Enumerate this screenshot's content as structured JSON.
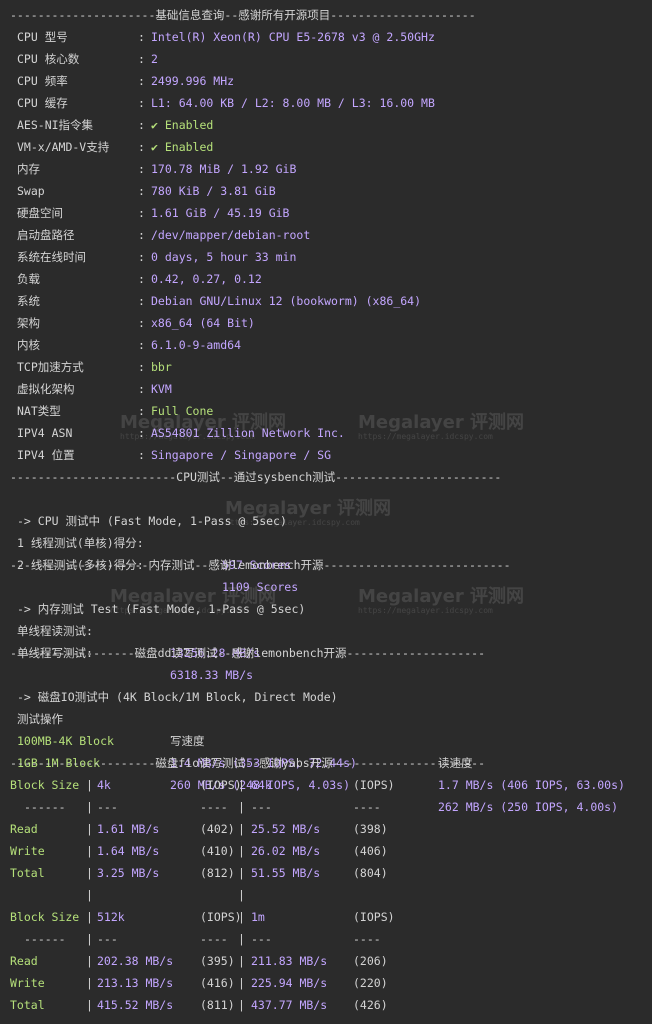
{
  "sections": {
    "basic": "---------------------基础信息查询--感谢所有开源项目---------------------",
    "cpu": "------------------------CPU测试--通过sysbench测试------------------------",
    "mem": "--------------------内存测试--感谢lemonbench开源---------------------------",
    "dd": "------------------磁盘dd读写测试--感谢lemonbench开源--------------------",
    "fio": "---------------------磁盘fio读写测试--感谢yabs开源----------------------"
  },
  "info": [
    {
      "label": "CPU 型号",
      "value": "Intel(R) Xeon(R) CPU E5-2678 v3 @ 2.50GHz"
    },
    {
      "label": "CPU 核心数",
      "value": "2"
    },
    {
      "label": "CPU 频率",
      "value": "2499.996 MHz"
    },
    {
      "label": "CPU 缓存",
      "value": "L1: 64.00 KB / L2: 8.00 MB / L3: 16.00 MB"
    },
    {
      "label": "AES-NI指令集",
      "value": "✔ Enabled"
    },
    {
      "label": "VM-x/AMD-V支持",
      "value": "✔ Enabled"
    },
    {
      "label": "内存",
      "value": "170.78 MiB / 1.92 GiB"
    },
    {
      "label": "Swap",
      "value": "780 KiB / 3.81 GiB"
    },
    {
      "label": "硬盘空间",
      "value": "1.61 GiB / 45.19 GiB"
    },
    {
      "label": "启动盘路径",
      "value": "/dev/mapper/debian-root"
    },
    {
      "label": "系统在线时间",
      "value": "0 days, 5 hour 33 min"
    },
    {
      "label": "负载",
      "value": "0.42, 0.27, 0.12"
    },
    {
      "label": "系统",
      "value": "Debian GNU/Linux 12 (bookworm) (x86_64)"
    },
    {
      "label": "架构",
      "value": "x86_64 (64 Bit)"
    },
    {
      "label": "内核",
      "value": "6.1.0-9-amd64"
    },
    {
      "label": "TCP加速方式",
      "value": "bbr"
    },
    {
      "label": "虚拟化架构",
      "value": "KVM"
    },
    {
      "label": "NAT类型",
      "value": "Full Cone"
    },
    {
      "label": "IPV4 ASN",
      "value": "AS54801 Zillion Network Inc."
    },
    {
      "label": "IPV4 位置",
      "value": "Singapore / Singapore / SG"
    }
  ],
  "colon": ":",
  "cpu_test": {
    "header": "-> CPU 测试中 (Fast Mode, 1-Pass @ 5sec)",
    "rows": [
      {
        "label": "1 线程测试(单核)得分:",
        "value": "597 Scores"
      },
      {
        "label": "2 线程测试(多核)得分:",
        "value": "1109 Scores"
      }
    ]
  },
  "mem_test": {
    "header": "-> 内存测试 Test (Fast Mode, 1-Pass @ 5sec)",
    "rows": [
      {
        "label": "单线程读测试:",
        "value": "13256.28 MB/s"
      },
      {
        "label": "单线程写测试:",
        "value": "6318.33 MB/s"
      }
    ]
  },
  "dd_test": {
    "header": "-> 磁盘IO测试中 (4K Block/1M Block, Direct Mode)",
    "columns": [
      "测试操作",
      "写速度",
      "读速度"
    ],
    "rows": [
      {
        "op": "100MB-4K Block",
        "write": "1.4 MB/s (353 IOPS, 72.44s)",
        "read": "1.7 MB/s (406 IOPS, 63.00s)"
      },
      {
        "op": "1GB-1M Block",
        "write": "260 MB/s (248 IOPS, 4.03s)",
        "read": "262 MB/s (250 IOPS, 4.00s)"
      }
    ]
  },
  "fio_test": {
    "tables": [
      {
        "head": [
          "Block Size",
          "4k",
          "(IOPS)",
          "64k",
          "(IOPS)"
        ],
        "dash": [
          "------",
          "---",
          "----",
          "---",
          "----"
        ],
        "rows": [
          [
            "Read",
            "1.61 MB/s",
            "(402)",
            "25.52 MB/s",
            "(398)"
          ],
          [
            "Write",
            "1.64 MB/s",
            "(410)",
            "26.02 MB/s",
            "(406)"
          ],
          [
            "Total",
            "3.25 MB/s",
            "(812)",
            "51.55 MB/s",
            "(804)"
          ]
        ]
      },
      {
        "head": [
          "Block Size",
          "512k",
          "(IOPS)",
          "1m",
          "(IOPS)"
        ],
        "dash": [
          "------",
          "---",
          "----",
          "---",
          "----"
        ],
        "rows": [
          [
            "Read",
            "202.38 MB/s",
            "(395)",
            "211.83 MB/s",
            "(206)"
          ],
          [
            "Write",
            "213.13 MB/s",
            "(416)",
            "225.94 MB/s",
            "(220)"
          ],
          [
            "Total",
            "415.52 MB/s",
            "(811)",
            "437.77 MB/s",
            "(426)"
          ]
        ]
      }
    ],
    "pipe": "|"
  },
  "watermarks": [
    {
      "title": "Megalayer 评测网",
      "url": "https://megalayer.idcspy.com"
    },
    {
      "title": "Megalayer 评测网",
      "url": "https://megalayer.idcspy.com"
    },
    {
      "title": "Megalayer 评测网",
      "url": "https://megalayer.idcspy.com"
    },
    {
      "title": "Megalayer 评测网",
      "url": "https://megalayer.idcspy.com"
    },
    {
      "title": "Megalayer 评测网",
      "url": "https://megalayer.idcspy.com"
    }
  ],
  "colors": {
    "background": "#2b2b2b",
    "text": "#d4d4d4",
    "number": "#c3a6ff",
    "green": "#b5e07a"
  }
}
